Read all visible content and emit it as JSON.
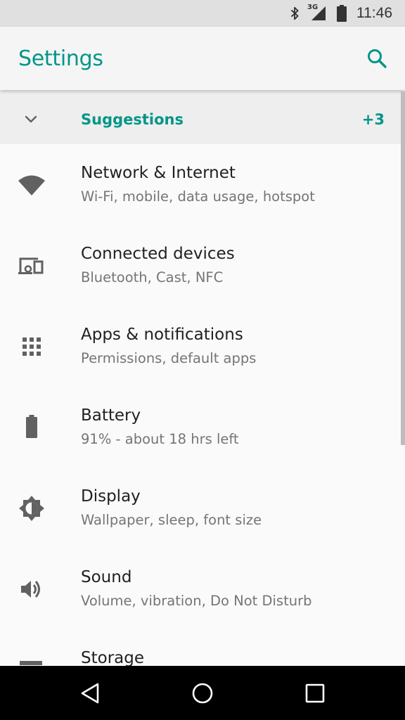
{
  "status_bar": {
    "network_label": "3G",
    "time": "11:46"
  },
  "app_bar": {
    "title": "Settings",
    "icons": [
      "search-icon"
    ]
  },
  "suggestions": {
    "label": "Suggestions",
    "count": "+3"
  },
  "settings": [
    {
      "icon": "wifi-icon",
      "title": "Network & Internet",
      "subtitle": "Wi-Fi, mobile, data usage, hotspot"
    },
    {
      "icon": "devices-icon",
      "title": "Connected devices",
      "subtitle": "Bluetooth, Cast, NFC"
    },
    {
      "icon": "apps-icon",
      "title": "Apps & notifications",
      "subtitle": "Permissions, default apps"
    },
    {
      "icon": "battery-icon",
      "title": "Battery",
      "subtitle": "91% - about 18 hrs left"
    },
    {
      "icon": "brightness-icon",
      "title": "Display",
      "subtitle": "Wallpaper, sleep, font size"
    },
    {
      "icon": "volume-icon",
      "title": "Sound",
      "subtitle": "Volume, vibration, Do Not Disturb"
    },
    {
      "icon": "storage-icon",
      "title": "Storage",
      "subtitle": ""
    }
  ],
  "colors": {
    "accent": "#009688",
    "primary_text": "#212121",
    "secondary_text": "#757575",
    "icon": "#616161"
  }
}
